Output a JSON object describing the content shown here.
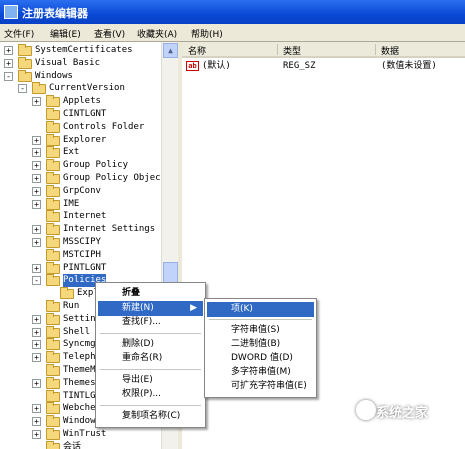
{
  "window": {
    "title": "注册表编辑器"
  },
  "menubar": [
    "文件(F)",
    "编辑(E)",
    "查看(V)",
    "收藏夹(A)",
    "帮助(H)"
  ],
  "tree": [
    {
      "label": "SystemCertificates",
      "expander": "+"
    },
    {
      "label": "Visual Basic",
      "expander": "+"
    },
    {
      "label": "Windows",
      "expander": "-"
    },
    {
      "label": "CurrentVersion",
      "expander": "-"
    },
    {
      "label": "Applets",
      "expander": "+"
    },
    {
      "label": "CINTLGNT",
      "expander": ""
    },
    {
      "label": "Controls Folder",
      "expander": ""
    },
    {
      "label": "Explorer",
      "expander": "+"
    },
    {
      "label": "Ext",
      "expander": "+"
    },
    {
      "label": "Group Policy",
      "expander": "+"
    },
    {
      "label": "Group Policy Objec",
      "expander": "+"
    },
    {
      "label": "GrpConv",
      "expander": "+"
    },
    {
      "label": "IME",
      "expander": "+"
    },
    {
      "label": "Internet",
      "expander": ""
    },
    {
      "label": "Internet Settings",
      "expander": "+"
    },
    {
      "label": "MSSCIPY",
      "expander": "+"
    },
    {
      "label": "MSTCIPH",
      "expander": ""
    },
    {
      "label": "PINTLGNT",
      "expander": "+"
    },
    {
      "label": "Policies",
      "expander": "-",
      "selected": true
    },
    {
      "label": "Expl",
      "expander": ""
    },
    {
      "label": "Run",
      "expander": ""
    },
    {
      "label": "Setting",
      "expander": "+"
    },
    {
      "label": "Shell N",
      "expander": "+"
    },
    {
      "label": "Syncmgr",
      "expander": "+"
    },
    {
      "label": "Telepho",
      "expander": "+"
    },
    {
      "label": "ThemeMa",
      "expander": ""
    },
    {
      "label": "Themes",
      "expander": "+"
    },
    {
      "label": "TINTLGN",
      "expander": ""
    },
    {
      "label": "Webchec",
      "expander": "+"
    },
    {
      "label": "Windowsupdate",
      "expander": "+"
    },
    {
      "label": "WinTrust",
      "expander": "+"
    },
    {
      "label": "会话",
      "expander": ""
    }
  ],
  "columns": [
    "名称",
    "类型",
    "数据"
  ],
  "values": [
    {
      "name": "(默认)",
      "type": "REG_SZ",
      "data": "(数值未设置)",
      "icon": "ab"
    }
  ],
  "context_menu": [
    {
      "label": "折叠",
      "bold": true
    },
    {
      "label": "新建(N)",
      "submenu": true,
      "highlight": true
    },
    {
      "label": "查找(F)..."
    },
    {
      "sep": true
    },
    {
      "label": "删除(D)"
    },
    {
      "label": "重命名(R)"
    },
    {
      "sep": true
    },
    {
      "label": "导出(E)"
    },
    {
      "label": "权限(P)..."
    },
    {
      "sep": true
    },
    {
      "label": "复制项名称(C)"
    }
  ],
  "submenu": [
    {
      "label": "项(K)",
      "highlight": true
    },
    {
      "sep": true
    },
    {
      "label": "字符串值(S)"
    },
    {
      "label": "二进制值(B)"
    },
    {
      "label": "DWORD 值(D)"
    },
    {
      "label": "多字符串值(M)"
    },
    {
      "label": "可扩充字符串值(E)"
    }
  ],
  "watermark": "系统之家",
  "colors": {
    "selection": "#316ac5",
    "titlebar": "#0a49d6",
    "menubar": "#ece9d8"
  }
}
